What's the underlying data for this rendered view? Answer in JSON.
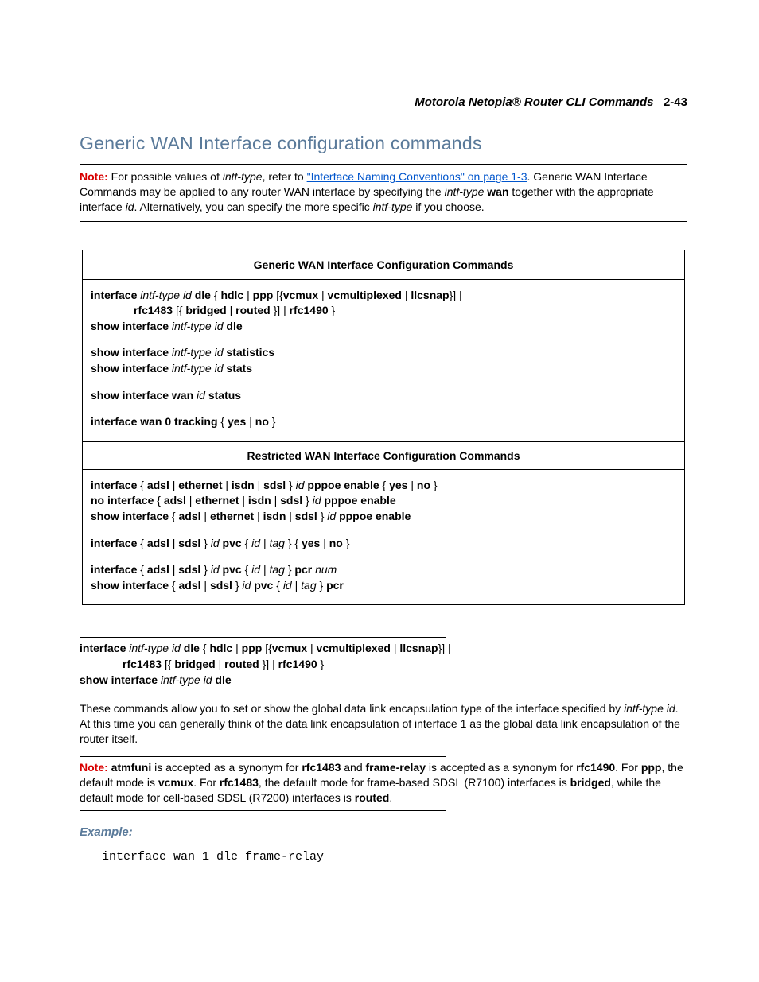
{
  "header": {
    "title": "Motorola Netopia® Router CLI Commands",
    "page": "2-43"
  },
  "section_title": "Generic WAN Interface configuration commands",
  "note1": {
    "label": "Note:",
    "pre": "For possible values of ",
    "it1": "intf-type",
    "mid1": ", refer to ",
    "link": "\"Interface Naming Conventions\" on page 1-3",
    "post1": ". Generic WAN Interface Commands may be applied to any router WAN interface by specifying the ",
    "it2": "intf-type",
    "b1": " wan",
    "post2": " together with the appropriate interface ",
    "it3": "id",
    "post3": ". Alternatively, you can specify the more specific ",
    "it4": "intf-type",
    "post4": " if you choose."
  },
  "table": {
    "header1": "Generic WAN Interface Configuration Commands",
    "header2": "Restricted WAN Interface Configuration Commands",
    "g1": {
      "l1a": "interface ",
      "l1b": "intf-type id ",
      "l1c": "dle ",
      "l1d": "{ ",
      "l1e": "hdlc ",
      "l1f": "| ",
      "l1g": "ppp ",
      "l1h": "[{",
      "l1i": "vcmux ",
      "l1j": "| ",
      "l1k": "vcmultiplexed ",
      "l1l": "| ",
      "l1m": "llcsnap",
      "l1n": "}] | ",
      "l2a": "rfc1483 ",
      "l2b": "[{ ",
      "l2c": "bridged ",
      "l2d": "| ",
      "l2e": "routed ",
      "l2f": "}] | ",
      "l2g": "rfc1490 ",
      "l2h": "}",
      "l3a": "show interface ",
      "l3b": "intf-type id ",
      "l3c": "dle"
    },
    "g2": {
      "l4a": "show interface ",
      "l4b": "intf-type id ",
      "l4c": "statistics",
      "l5a": "show interface ",
      "l5b": "intf-type id ",
      "l5c": "stats"
    },
    "g3": {
      "l6a": "show interface wan ",
      "l6b": "id ",
      "l6c": "status"
    },
    "g4": {
      "l7a": "interface wan 0 tracking ",
      "l7b": "{ ",
      "l7c": "yes ",
      "l7d": "| ",
      "l7e": "no ",
      "l7f": "}"
    },
    "r1": {
      "l8a": "interface ",
      "l8b": "{ ",
      "l8c": "adsl ",
      "l8d": "| ",
      "l8e": "ethernet  ",
      "l8f": "| ",
      "l8g": "isdn ",
      "l8h": "| ",
      "l8i": "sdsl ",
      "l8j": "} ",
      "l8k": "id ",
      "l8l": "pppoe enable ",
      "l8m": "{ ",
      "l8n": "yes ",
      "l8o": "| ",
      "l8p": "no ",
      "l8q": "}",
      "l9a": "no interface ",
      "l9b": "{ ",
      "l9c": "adsl ",
      "l9d": "| ",
      "l9e": "ethernet  ",
      "l9f": "| ",
      "l9g": "isdn ",
      "l9h": "| ",
      "l9i": "sdsl ",
      "l9j": "} ",
      "l9k": "id ",
      "l9l": "pppoe enable",
      "l10a": "show interface ",
      "l10b": "{ ",
      "l10c": "adsl ",
      "l10d": "| ",
      "l10e": "ethernet  ",
      "l10f": "| ",
      "l10g": "isdn ",
      "l10h": "| ",
      "l10i": "sdsl ",
      "l10j": "} ",
      "l10k": "id ",
      "l10l": "pppoe enable"
    },
    "r2": {
      "l11a": "interface ",
      "l11b": "{ ",
      "l11c": "adsl ",
      "l11d": "| ",
      "l11e": "sdsl ",
      "l11f": "} ",
      "l11g": "id ",
      "l11h": "pvc ",
      "l11i": "{ ",
      "l11j": "id ",
      "l11k": "| ",
      "l11l": "tag ",
      "l11m": "} { ",
      "l11n": "yes ",
      "l11o": "| ",
      "l11p": "no ",
      "l11q": "}"
    },
    "r3": {
      "l12a": "interface ",
      "l12b": "{ ",
      "l12c": "adsl ",
      "l12d": "| ",
      "l12e": "sdsl ",
      "l12f": "} ",
      "l12g": "id ",
      "l12h": "pvc ",
      "l12i": "{ ",
      "l12j": "id ",
      "l12k": "| ",
      "l12l": "tag ",
      "l12m": "} ",
      "l12n": "pcr ",
      "l12o": "num",
      "l13a": "show interface ",
      "l13b": "{ ",
      "l13c": "adsl ",
      "l13d": "| ",
      "l13e": "sdsl ",
      "l13f": "} ",
      "l13g": "id ",
      "l13h": "pvc ",
      "l13i": "{ ",
      "l13j": "id ",
      "l13k": "| ",
      "l13l": "tag ",
      "l13m": "} ",
      "l13n": "pcr"
    }
  },
  "syntax2": {
    "l1a": "interface ",
    "l1b": "intf-type id ",
    "l1c": "dle ",
    "l1d": "{ ",
    "l1e": "hdlc ",
    "l1f": "| ",
    "l1g": "ppp ",
    "l1h": "[{",
    "l1i": "vcmux ",
    "l1j": "| ",
    "l1k": "vcmultiplexed ",
    "l1l": "| ",
    "l1m": "llcsnap",
    "l1n": "}] | ",
    "l2a": "rfc1483 ",
    "l2b": "[{ ",
    "l2c": "bridged ",
    "l2d": "| ",
    "l2e": "routed ",
    "l2f": "}] | ",
    "l2g": "rfc1490 ",
    "l2h": "}",
    "l3a": "show interface ",
    "l3b": "intf-type id ",
    "l3c": "dle"
  },
  "desc": {
    "pre": "These commands allow you to set or show the global data link encapsulation type of the interface specified by ",
    "it1": "intf-type id",
    "post": ". At this time you can generally think of the data link encapsulation of interface 1 as the global data link encapsulation of the router itself."
  },
  "note2": {
    "label": "Note:",
    "b1": "atmfuni",
    "t1": " is accepted as a synonym for ",
    "b2": "rfc1483",
    "t2": " and ",
    "b3": "frame-relay",
    "t3": " is accepted as a synonym for ",
    "b4": "rfc1490",
    "t4": ". For ",
    "b5": "ppp",
    "t5": ", the default mode is ",
    "b6": "vcmux",
    "t6": ". For ",
    "b7": "rfc1483",
    "t7": ", the default mode for frame-based SDSL (R7100) interfaces is ",
    "b8": "bridged",
    "t8": ", while the default mode for cell-based SDSL (R7200) interfaces is ",
    "b9": "routed",
    "t9": "."
  },
  "example": {
    "label": "Example:",
    "code": "interface wan 1 dle frame-relay"
  }
}
